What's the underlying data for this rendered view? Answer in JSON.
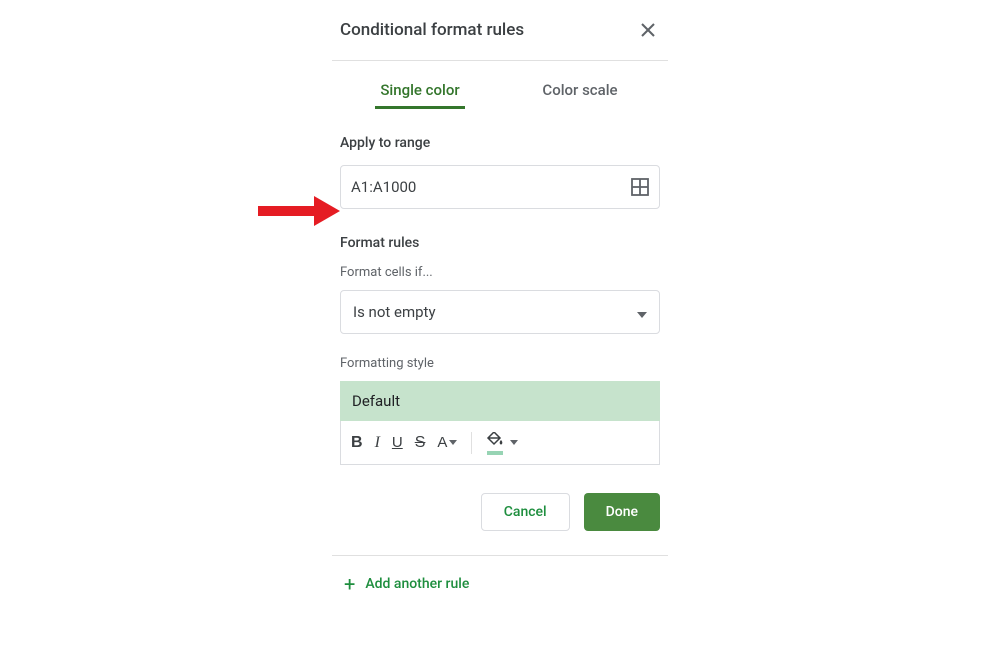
{
  "header": {
    "title": "Conditional format rules"
  },
  "tabs": {
    "single_color": "Single color",
    "color_scale": "Color scale"
  },
  "apply_range": {
    "label": "Apply to range",
    "value": "A1:A1000"
  },
  "format_rules": {
    "label": "Format rules",
    "cells_if_label": "Format cells if...",
    "condition": "Is not empty"
  },
  "formatting_style": {
    "label": "Formatting style",
    "preview": "Default"
  },
  "buttons": {
    "cancel": "Cancel",
    "done": "Done"
  },
  "add_rule": {
    "label": "Add another rule"
  }
}
